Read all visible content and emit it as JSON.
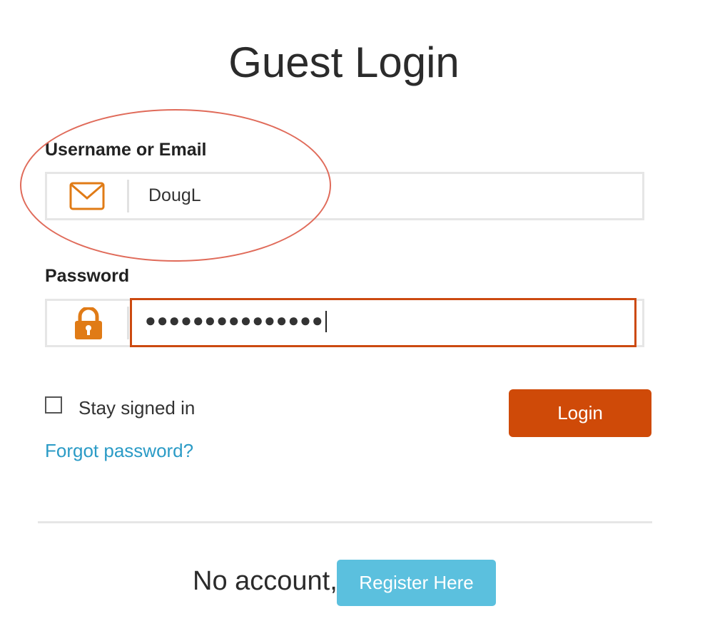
{
  "title": "Guest Login",
  "username": {
    "label": "Username or Email",
    "value": "DougL",
    "icon": "envelope-icon"
  },
  "password": {
    "label": "Password",
    "masked_value": "●●●●●●●●●●●●●●●",
    "icon": "lock-icon"
  },
  "remember": {
    "label": "Stay signed in",
    "checked": false
  },
  "forgot_link": "Forgot password?",
  "login_button": "Login",
  "footer": {
    "prompt": "No account,",
    "register_button": "Register Here"
  },
  "colors": {
    "accent": "#cf4a08",
    "icon": "#e07b16",
    "link": "#2b9bc6",
    "register": "#5bc0de",
    "annotation": "#e06b5a"
  }
}
